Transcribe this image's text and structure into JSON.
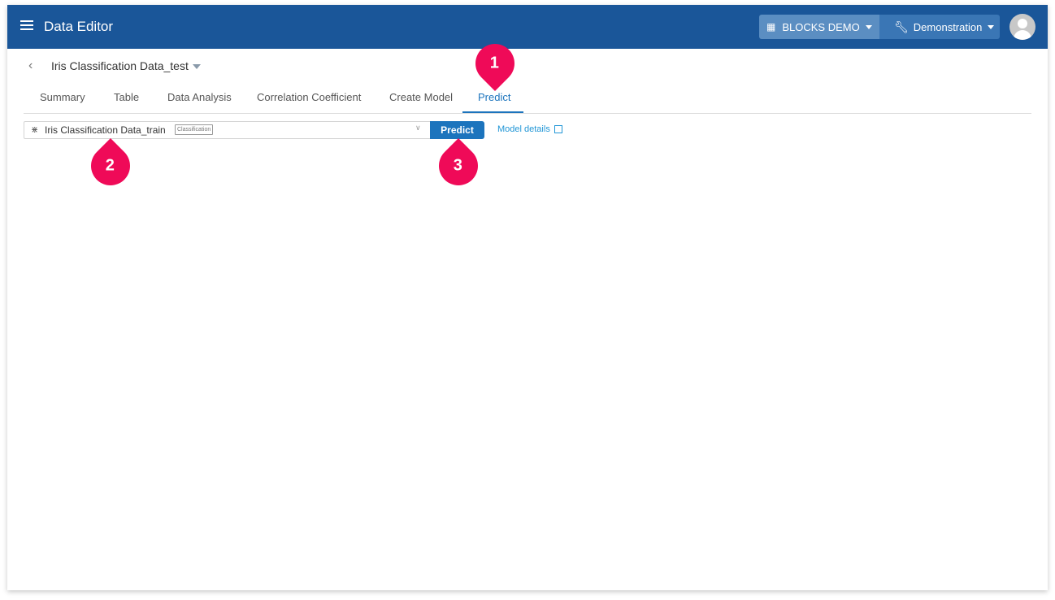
{
  "header": {
    "app_title": "Data Editor",
    "org_label": "BLOCKS DEMO",
    "project_label": "Demonstration",
    "colors": {
      "header_bg": "#1a5699",
      "accent": "#1c74bd",
      "marker": "#ef0a58"
    }
  },
  "dataset": {
    "title": "Iris Classification Data_test"
  },
  "tabs": [
    {
      "label": "Summary",
      "active": false
    },
    {
      "label": "Table",
      "active": false
    },
    {
      "label": "Data Analysis",
      "active": false
    },
    {
      "label": "Correlation Coefficient",
      "active": false
    },
    {
      "label": "Create Model",
      "active": false
    },
    {
      "label": "Predict",
      "active": true
    }
  ],
  "predict": {
    "model_name": "Iris Classification Data_train",
    "model_type_badge": "Classification",
    "predict_button_label": "Predict",
    "model_details_label": "Model details"
  },
  "markers": [
    "1",
    "2",
    "3"
  ]
}
